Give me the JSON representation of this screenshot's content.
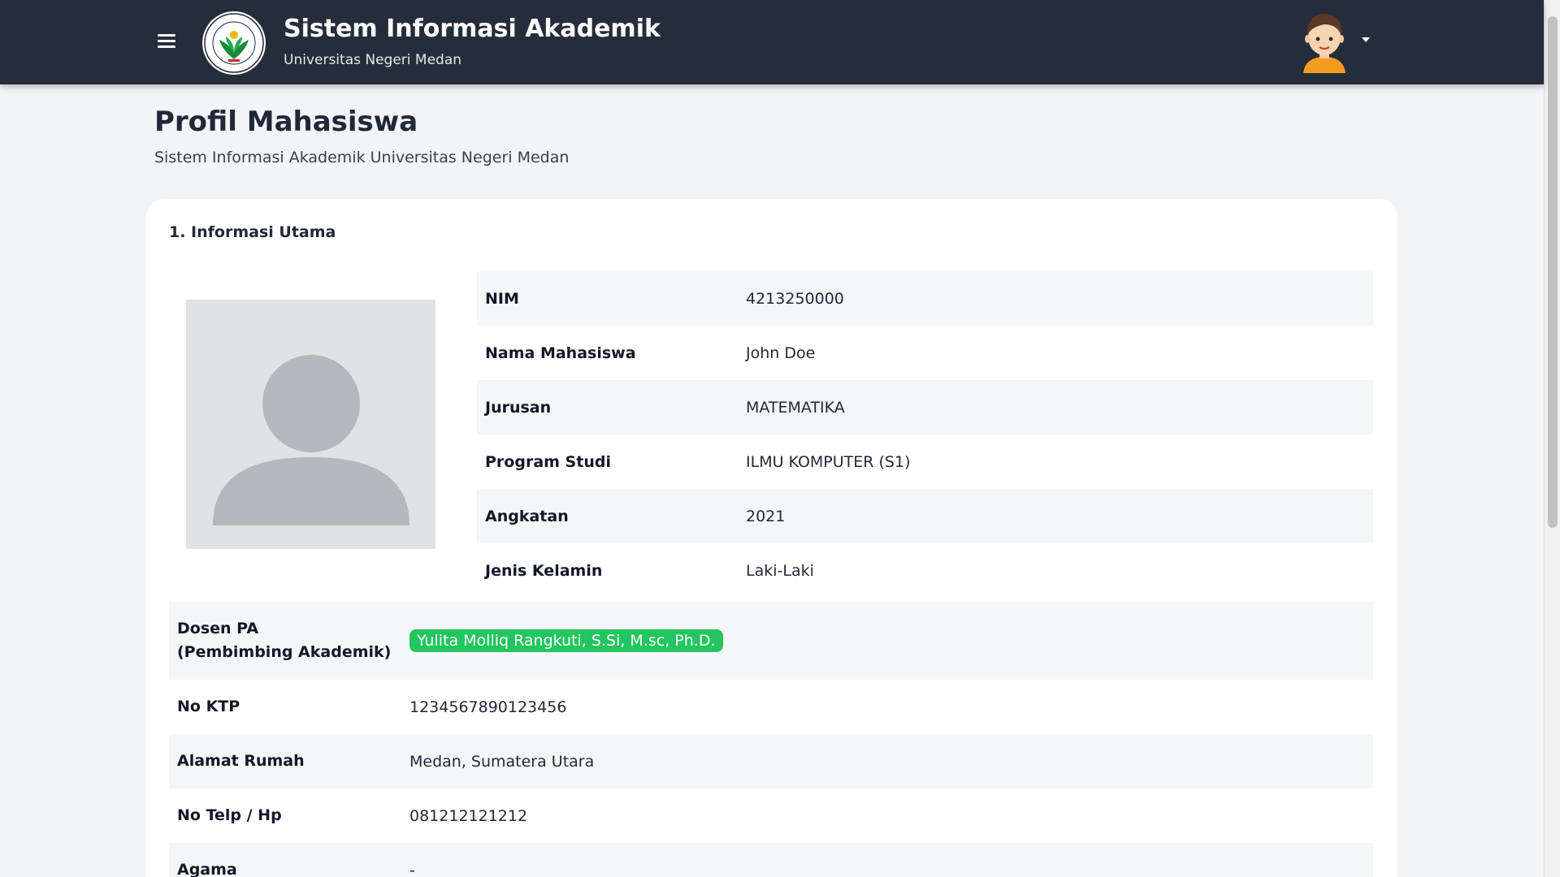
{
  "header": {
    "title": "Sistem Informasi Akademik",
    "subtitle": "Universitas Negeri Medan",
    "logo_icon": "unimed-logo-icon",
    "menu_icon": "hamburger-menu-icon",
    "user_icon": "user-avatar-icon",
    "bg_color": "#262d3a"
  },
  "page": {
    "title": "Profil Mahasiswa",
    "subtitle": "Sistem Informasi Akademik Universitas Negeri Medan"
  },
  "section": {
    "title": "1. Informasi Utama"
  },
  "profile": {
    "photo_icon": "avatar-placeholder-icon",
    "rows": [
      {
        "label": "NIM",
        "value": "4213250000"
      },
      {
        "label": "Nama Mahasiswa",
        "value": "John Doe"
      },
      {
        "label": "Jurusan",
        "value": "MATEMATIKA"
      },
      {
        "label": "Program Studi",
        "value": "ILMU KOMPUTER (S1)"
      },
      {
        "label": "Angkatan",
        "value": "2021"
      },
      {
        "label": "Jenis Kelamin",
        "value": "Laki-Laki"
      }
    ]
  },
  "details": {
    "dosen_pa": {
      "label_line1": "Dosen PA",
      "label_line2": "(Pembimbing Akademik)",
      "value": "Yulita Molliq Rangkuti, S.Si, M.sc, Ph.D.",
      "badge_color": "#22c55e"
    },
    "rows": [
      {
        "label": "No KTP",
        "value": "1234567890123456"
      },
      {
        "label": "Alamat Rumah",
        "value": "Medan, Sumatera Utara"
      },
      {
        "label": "No Telp / Hp",
        "value": "081212121212"
      },
      {
        "label": "Agama",
        "value": "-"
      }
    ]
  }
}
